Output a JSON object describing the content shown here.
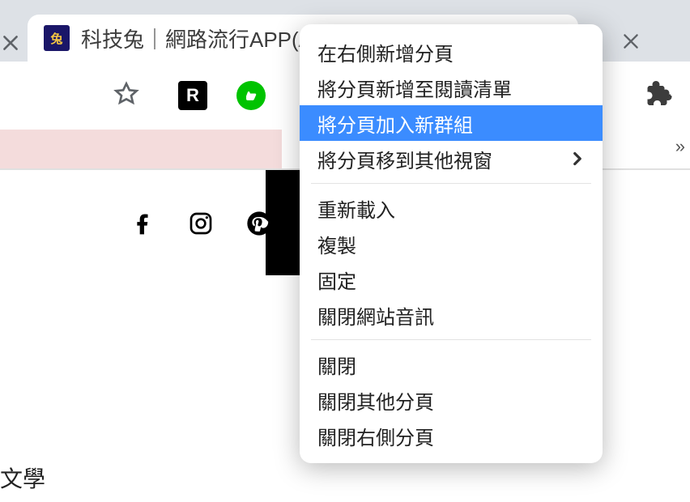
{
  "tab": {
    "title": "科技兔｜網路流行APP(A",
    "favicon_label": "兔"
  },
  "toolbar": {
    "ext_r_label": "R"
  },
  "page": {
    "footer_text": "文學"
  },
  "context_menu": {
    "items": [
      {
        "label": "在右側新增分頁",
        "has_arrow": false
      },
      {
        "label": "將分頁新增至閱讀清單",
        "has_arrow": false
      },
      {
        "label": "將分頁加入新群組",
        "has_arrow": false,
        "hovered": true
      },
      {
        "label": "將分頁移到其他視窗",
        "has_arrow": true
      }
    ],
    "group2": [
      {
        "label": "重新載入"
      },
      {
        "label": "複製"
      },
      {
        "label": "固定"
      },
      {
        "label": "關閉網站音訊"
      }
    ],
    "group3": [
      {
        "label": "關閉"
      },
      {
        "label": "關閉其他分頁"
      },
      {
        "label": "關閉右側分頁"
      }
    ]
  }
}
